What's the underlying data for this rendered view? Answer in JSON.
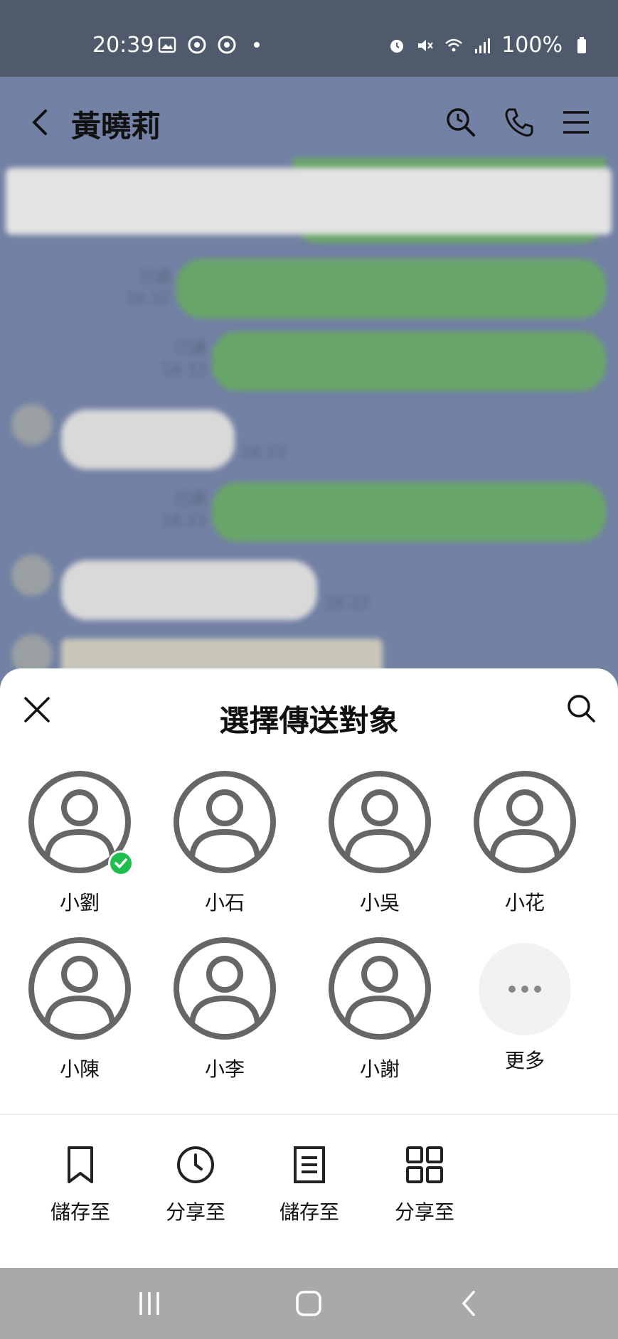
{
  "status_bar": {
    "time": "20:39",
    "battery": "100%",
    "left_icons": [
      "image-icon",
      "chrome-icon",
      "chrome-icon",
      "dot-icon"
    ],
    "right_icons": [
      "alarm-icon",
      "mute-icon",
      "wifi-icon",
      "signal-icon",
      "battery-icon"
    ]
  },
  "chat_header": {
    "title": "黃曉莉",
    "icons": [
      "back-icon",
      "search-history-icon",
      "phone-icon",
      "menu-icon"
    ]
  },
  "chat": {
    "messages": [
      {
        "from": "me",
        "read": "已讀",
        "time": "16:32"
      },
      {
        "from": "me",
        "read": "已讀",
        "time": "16:33"
      },
      {
        "from": "other",
        "time": "16:33"
      },
      {
        "from": "me",
        "read": "已讀",
        "time": "16:33"
      },
      {
        "from": "other",
        "time": "16:33"
      }
    ]
  },
  "share_sheet": {
    "title": "選擇傳送對象",
    "contacts": [
      {
        "name": "小劉",
        "selected": true
      },
      {
        "name": "小石",
        "selected": false
      },
      {
        "name": "小吳",
        "selected": false
      },
      {
        "name": "小花",
        "selected": false
      },
      {
        "name": "小陳",
        "selected": false
      },
      {
        "name": "小李",
        "selected": false
      },
      {
        "name": "小謝",
        "selected": false
      }
    ],
    "more_label": "更多",
    "actions": [
      {
        "label": "儲存至",
        "icon": "bookmark-icon"
      },
      {
        "label": "分享至",
        "icon": "clock-icon"
      },
      {
        "label": "儲存至",
        "icon": "note-icon"
      },
      {
        "label": "分享至",
        "icon": "grid-icon"
      }
    ]
  },
  "colors": {
    "accent_green": "#1fbe4e",
    "chat_bg": "#7281a4",
    "bubble_me": "#69a569"
  }
}
